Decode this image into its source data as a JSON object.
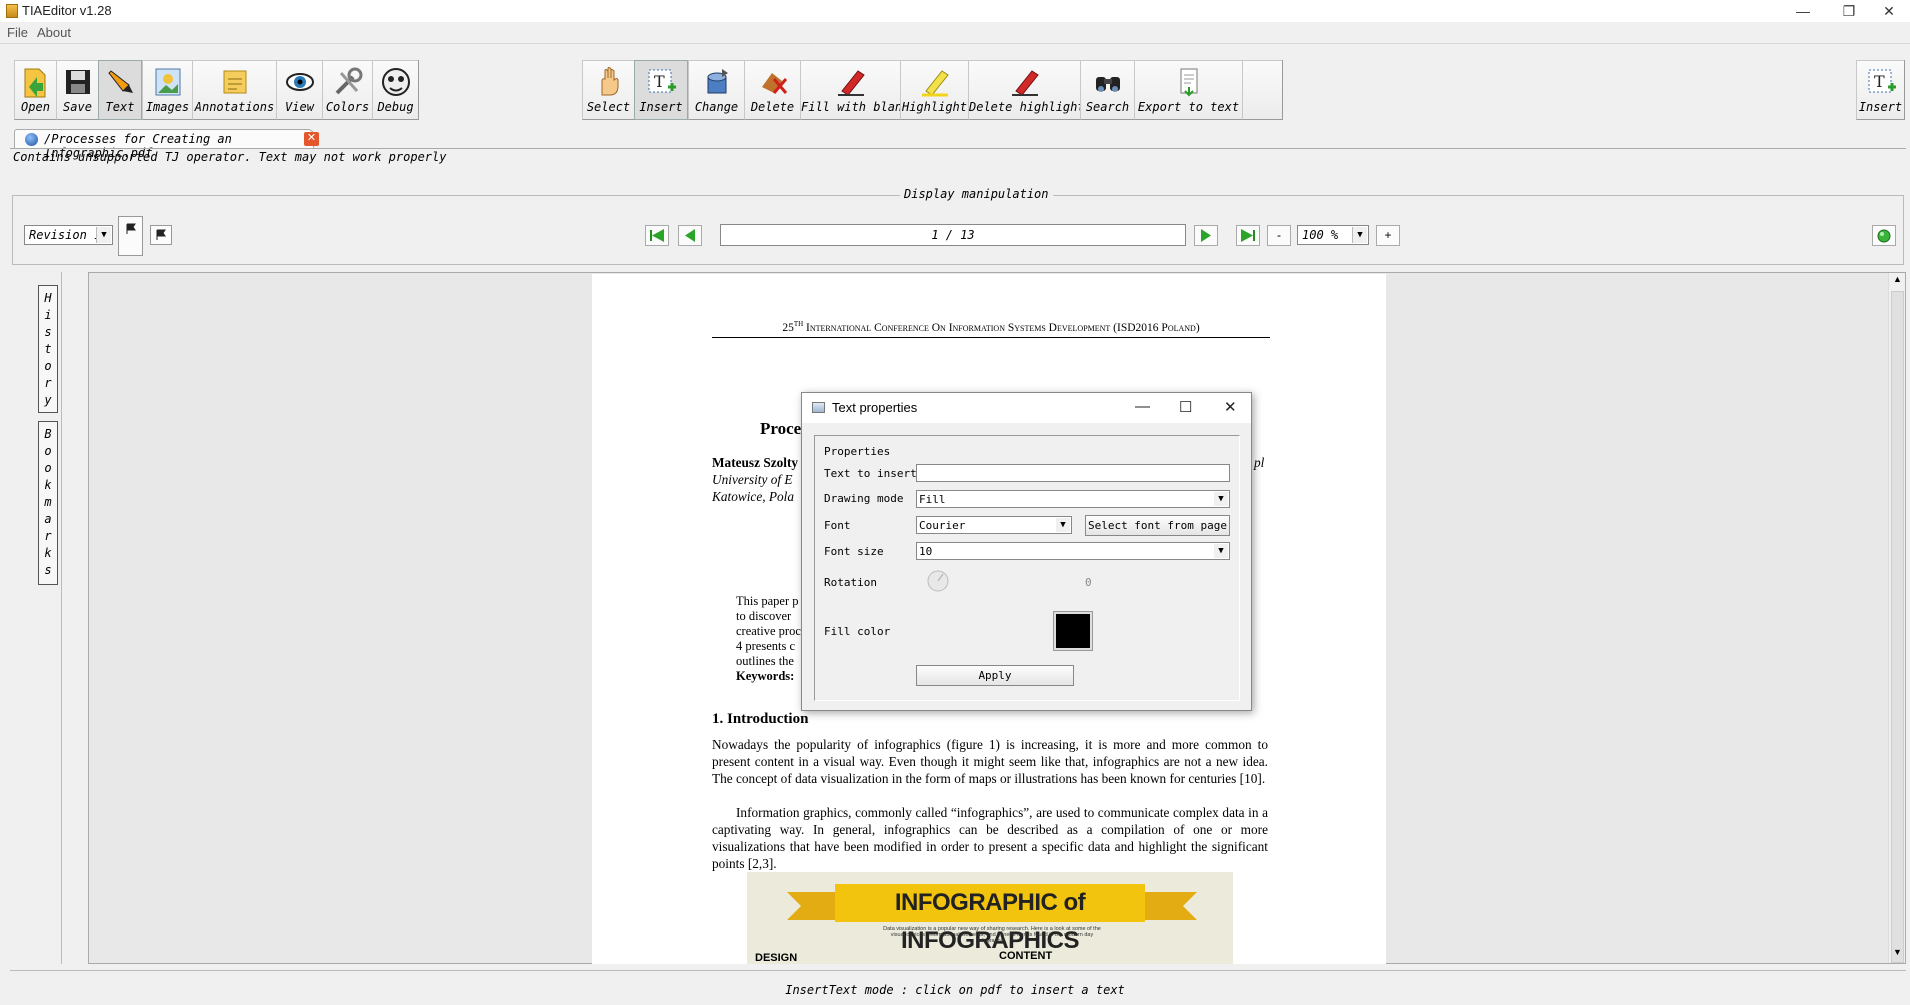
{
  "window": {
    "title": "TIAEditor v1.28",
    "minimize": "—",
    "restore": "❐",
    "close": "✕"
  },
  "menu": [
    "File",
    "About"
  ],
  "toolbar_left": [
    {
      "id": "open",
      "label": "Open",
      "icon": "open-icon"
    },
    {
      "id": "save",
      "label": "Save",
      "icon": "save-icon"
    },
    {
      "id": "text",
      "label": "Text",
      "icon": "text-pen-icon"
    },
    {
      "id": "images",
      "label": "Images",
      "icon": "images-icon"
    },
    {
      "id": "annotations",
      "label": "Annotations",
      "icon": "annotations-icon"
    },
    {
      "id": "view",
      "label": "View",
      "icon": "eye-icon"
    },
    {
      "id": "colors",
      "label": "Colors",
      "icon": "colors-icon"
    },
    {
      "id": "debug",
      "label": "Debug",
      "icon": "debug-icon"
    }
  ],
  "toolbar_center": [
    {
      "id": "select",
      "label": "Select",
      "icon": "hand-icon"
    },
    {
      "id": "insert",
      "label": "Insert",
      "icon": "insert-text-icon"
    },
    {
      "id": "change",
      "label": "Change",
      "icon": "change-icon"
    },
    {
      "id": "delete",
      "label": "Delete",
      "icon": "delete-icon"
    },
    {
      "id": "fill_blank",
      "label": "Fill with blank",
      "icon": "marker-icon"
    },
    {
      "id": "highlight",
      "label": "Highlight",
      "icon": "highlighter-icon"
    },
    {
      "id": "delete_highlight",
      "label": "Delete highlight",
      "icon": "delete-highlight-icon"
    },
    {
      "id": "search",
      "label": "Search",
      "icon": "binoculars-icon"
    },
    {
      "id": "export_text",
      "label": "Export to text",
      "icon": "export-text-icon"
    }
  ],
  "toolbar_right": {
    "label": "Insert",
    "icon": "insert-text-icon"
  },
  "tab": {
    "title": "/Processes for Creating an Infographic.pdf",
    "close": "✕"
  },
  "warning": "Contains unsupported TJ operator. Text may not work properly",
  "display": {
    "title": "Display manipulation",
    "revision": "Revision 1",
    "page_indicator": "1 / 13",
    "zoom": "100 %",
    "zoom_minus": "-",
    "zoom_plus": "+"
  },
  "sidebar": {
    "history": [
      "H",
      "i",
      "s",
      "t",
      "o",
      "r",
      "y"
    ],
    "bookmarks": [
      "B",
      "o",
      "o",
      "k",
      "m",
      "a",
      "r",
      "k",
      "s"
    ]
  },
  "pdf": {
    "header_num": "25",
    "header_sup": "TH",
    "header": "International Conference On Information Systems Development (ISD2016 Poland)",
    "title_fragment": "Proce",
    "author_fragment": "Mateusz Szolty",
    "affil1": "University of E",
    "affil2": "Katowice, Pola",
    "email_fragment": "pl",
    "abstract": [
      "This paper p",
      "to discover ",
      "creative proc",
      "4 presents c",
      "outlines the"
    ],
    "keywords_label": "Keywords:",
    "section": "1.   Introduction",
    "para1": "Nowadays the popularity of infographics (figure 1) is increasing, it is more and more common to present content in a visual way. Even though it might seem like that, infographics are not a new idea. The concept of data visualization in the form of maps or illustrations has been known for centuries [10].",
    "para2": "Information graphics, commonly called “infographics”, are used to communicate complex data in a captivating way. In general, infographics can be described as a compilation of one or more visualizations that have been modified in order to present a specific data and highlight the significant points [2,3].",
    "image_banner": "INFOGRAPHIC of INFOGRAPHICS",
    "image_sub": "Data visualization is a popular new way of sharing research. Here is a look at some of the visual devices, informational elements, and general trends found in the modern day infographic.",
    "image_col1": "DESIGN",
    "image_col2": "CONTENT"
  },
  "dialog": {
    "title": "Text properties",
    "group": "Properties",
    "labels": {
      "text": "Text to insert",
      "drawing_mode": "Drawing mode",
      "font": "Font",
      "font_size": "Font size",
      "rotation": "Rotation",
      "fill_color": "Fill color"
    },
    "values": {
      "text": "",
      "drawing_mode": "Fill",
      "font": "Courier",
      "font_size": "10",
      "rotation": "0"
    },
    "select_font_button": "Select font from page",
    "apply_button": "Apply",
    "fill_color_hex": "#000000"
  },
  "status": "InsertText mode : click on pdf to insert a text"
}
